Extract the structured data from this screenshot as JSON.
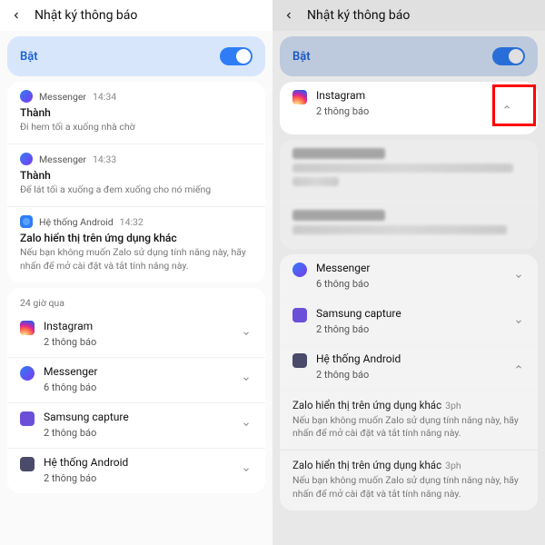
{
  "left": {
    "header": {
      "title": "Nhật ký thông báo"
    },
    "toggle": {
      "label": "Bật"
    },
    "notifications": [
      {
        "app": "Messenger",
        "time": "14:34",
        "title": "Thành",
        "body": "Đi hem tối a xuống nhà chờ"
      },
      {
        "app": "Messenger",
        "time": "14:33",
        "title": "Thành",
        "body": "Để lát tối a xuống a đem xuống cho nó miếng"
      },
      {
        "app": "Hệ thống Android",
        "time": "14:32",
        "title": "Zalo hiển thị trên ứng dụng khác",
        "body": "Nếu bạn không muốn Zalo sử dụng tính năng này, hãy nhấn để mở cài đặt và tắt tính năng này."
      }
    ],
    "section_label": "24 giờ qua",
    "summaries": [
      {
        "app": "Instagram",
        "count": "2 thông báo"
      },
      {
        "app": "Messenger",
        "count": "6 thông báo"
      },
      {
        "app": "Samsung capture",
        "count": "2 thông báo"
      },
      {
        "app": "Hệ thống Android",
        "count": "2 thông báo"
      }
    ]
  },
  "right": {
    "header": {
      "title": "Nhật ký thông báo"
    },
    "toggle": {
      "label": "Bật"
    },
    "expanded": {
      "app": "Instagram",
      "count": "2 thông báo"
    },
    "summaries": [
      {
        "app": "Messenger",
        "count": "6 thông báo"
      },
      {
        "app": "Samsung capture",
        "count": "2 thông báo"
      },
      {
        "app": "Hệ thống Android",
        "count": "2 thông báo"
      }
    ],
    "detail_items": [
      {
        "title": "Zalo hiển thị trên ứng dụng khác",
        "time": "3ph",
        "body": "Nếu bạn không muốn Zalo sử dụng tính năng này, hãy nhấn để mở cài đặt và tắt tính năng này."
      },
      {
        "title": "Zalo hiển thị trên ứng dụng khác",
        "time": "3ph",
        "body": "Nếu bạn không muốn Zalo sử dụng tính năng này, hãy nhấn để mở cài đặt và tắt tính năng này."
      }
    ]
  }
}
